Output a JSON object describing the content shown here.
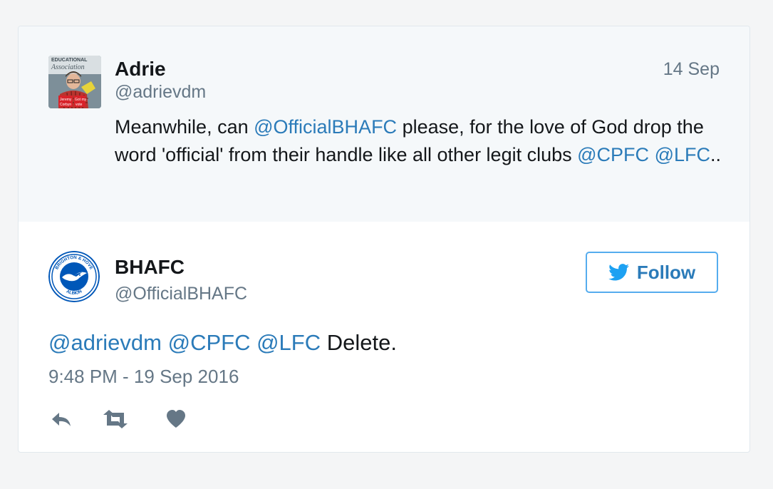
{
  "quoted_tweet": {
    "author_name": "Adrie",
    "author_handle": "@adrievdm",
    "date": "14 Sep",
    "text": {
      "part1": "Meanwhile, can ",
      "mention1": "@OfficialBHAFC",
      "part2": " please, for the love of God drop the word 'official' from their handle like all other legit clubs ",
      "mention2": "@CPFC",
      "part3": " ",
      "mention3": "@LFC",
      "part4": ".."
    },
    "avatar": {
      "sign_line1": "EDUCATIONAL",
      "sign_line2": "Association",
      "badge_line1": "Jeremy",
      "badge_line2": "Corbyn",
      "badge_line3": "Got my",
      "badge_line4": "vote"
    }
  },
  "main_tweet": {
    "author_name": "BHAFC",
    "author_handle": "@OfficialBHAFC",
    "follow_label": "Follow",
    "text": {
      "mention1": "@adrievdm",
      "mention2": "@CPFC",
      "mention3": "@LFC",
      "body": " Delete."
    },
    "timestamp": "9:48 PM - 19 Sep 2016",
    "crest": {
      "top_text": "BRIGHTON & HOVE",
      "bottom_text": "ALBION"
    }
  },
  "actions": {
    "reply_icon": "reply-icon",
    "retweet_icon": "retweet-icon",
    "like_icon": "heart-icon"
  },
  "colors": {
    "link": "#2b7bb9",
    "follow_border": "#55acee",
    "twitter_blue": "#1da1f2",
    "muted_text": "#657786",
    "action_icon": "#657786",
    "crest_blue": "#0057b8",
    "quoted_background": "#f5f8fa"
  }
}
